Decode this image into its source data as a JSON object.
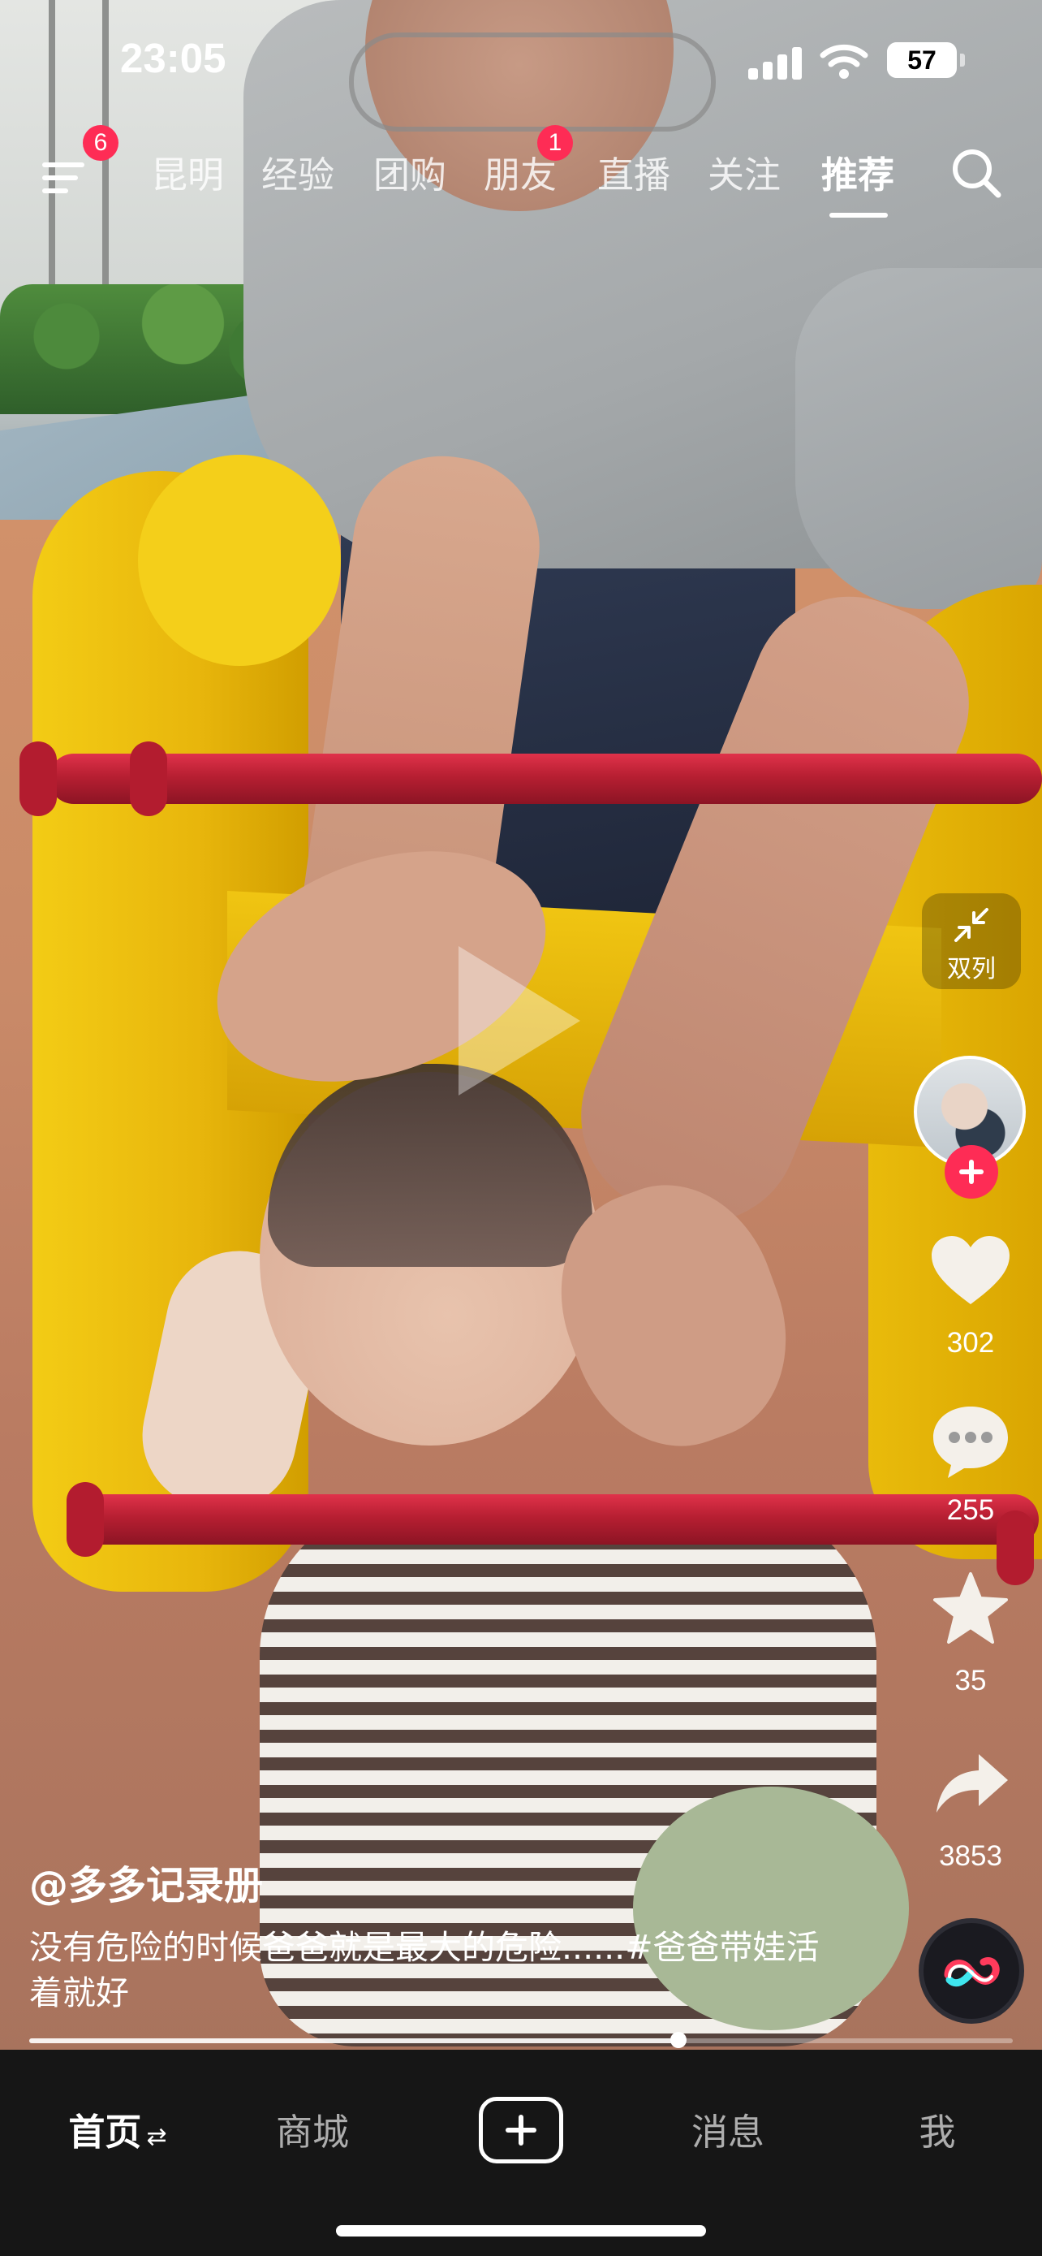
{
  "status_bar": {
    "time": "23:05",
    "battery": "57",
    "battery_level": 0.57
  },
  "top_nav": {
    "menu_badge": "6",
    "tabs": [
      {
        "label": "昆明"
      },
      {
        "label": "经验"
      },
      {
        "label": "团购"
      },
      {
        "label": "朋友",
        "badge": "1"
      },
      {
        "label": "直播"
      },
      {
        "label": "关注"
      },
      {
        "label": "推荐",
        "active": true
      }
    ]
  },
  "rail": {
    "collapse_label": "双列",
    "likes": "302",
    "comments": "255",
    "favorites": "35",
    "shares": "3853"
  },
  "video": {
    "author": "@多多记录册",
    "caption": "没有危险的时候爸爸就是最大的危险......#爸爸带娃活着就好",
    "progress": 0.66
  },
  "tab_bar": {
    "home": "首页",
    "home_swap": "⇄",
    "mall": "商城",
    "messages": "消息",
    "me": "我"
  },
  "colors": {
    "accent": "#fe2c55",
    "tab_bar_bg": "#161616"
  }
}
